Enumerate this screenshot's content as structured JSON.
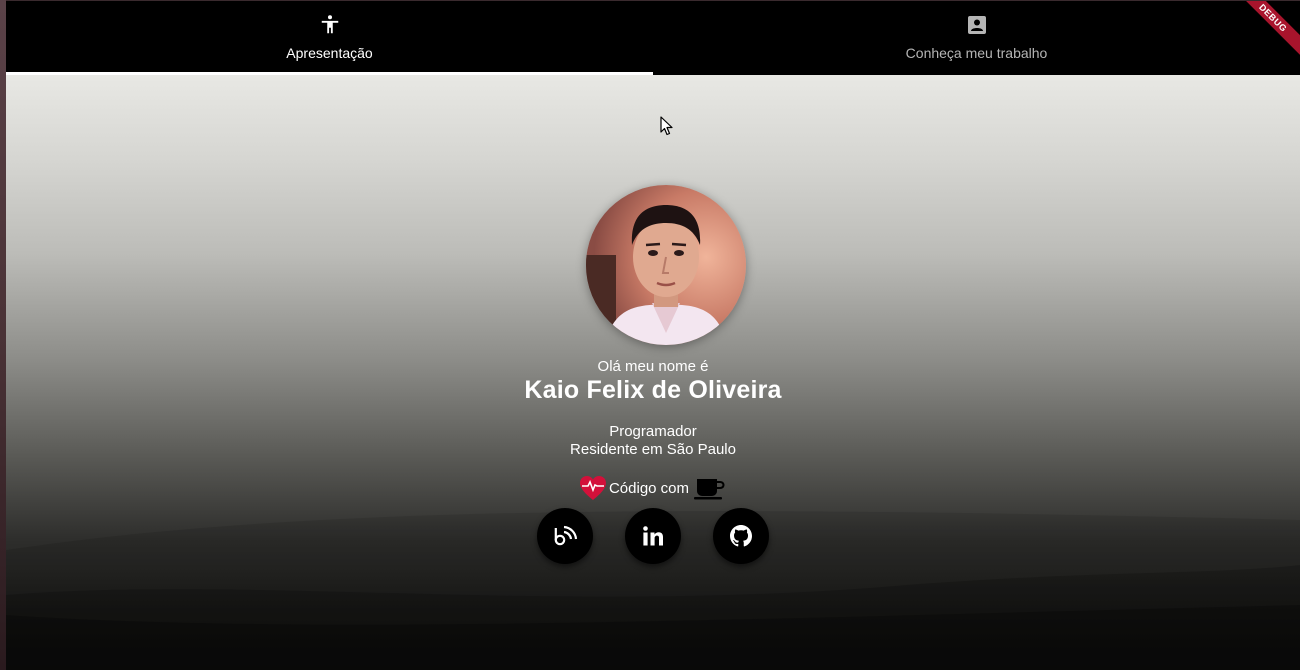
{
  "tabs": [
    {
      "label": "Apresentação",
      "icon": "accessibility-icon",
      "active": true
    },
    {
      "label": "Conheça meu trabalho",
      "icon": "portrait-icon",
      "active": false
    }
  ],
  "debug_banner": "DEBUG",
  "profile": {
    "greeting": "Olá meu nome é",
    "name": "Kaio Felix de Oliveira",
    "role": "Programador",
    "location": "Residente em São Paulo",
    "code_with": "Código com",
    "heart_icon": "heartbeat-icon",
    "coffee_icon": "coffee-icon"
  },
  "social_links": [
    {
      "icon": "blogger-rss-icon",
      "name": "blog"
    },
    {
      "icon": "linkedin-icon",
      "name": "linkedin"
    },
    {
      "icon": "github-icon",
      "name": "github"
    }
  ],
  "colors": {
    "tabbar_bg": "#000000",
    "heart": "#d3103a",
    "debug_banner": "#a8142c"
  }
}
